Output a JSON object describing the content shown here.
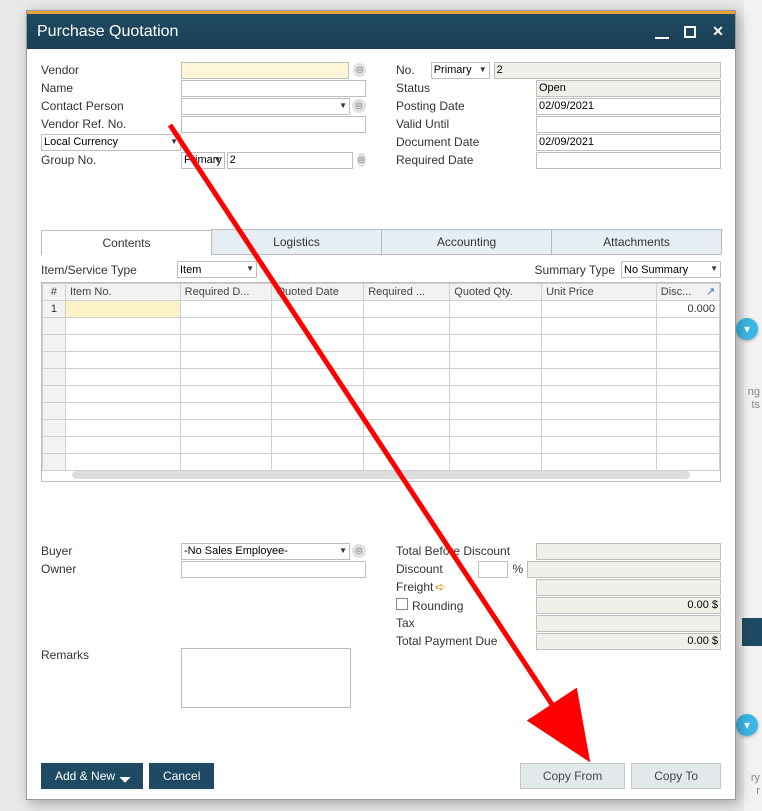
{
  "window": {
    "title": "Purchase Quotation"
  },
  "left_fields": {
    "vendor_label": "Vendor",
    "name_label": "Name",
    "contact_label": "Contact Person",
    "vendorref_label": "Vendor Ref. No.",
    "currency_label": "Local Currency",
    "groupno_label": "Group No.",
    "group_primary": "Primary",
    "group_value": "2"
  },
  "right_fields": {
    "no_label": "No.",
    "no_primary": "Primary",
    "no_value": "2",
    "status_label": "Status",
    "status_value": "Open",
    "posting_label": "Posting Date",
    "posting_value": "02/09/2021",
    "valid_label": "Valid Until",
    "docdate_label": "Document Date",
    "docdate_value": "02/09/2021",
    "required_label": "Required Date"
  },
  "tabs": {
    "contents": "Contents",
    "logistics": "Logistics",
    "accounting": "Accounting",
    "attachments": "Attachments"
  },
  "sub": {
    "itemtype_label": "Item/Service Type",
    "itemtype_value": "Item",
    "summary_label": "Summary Type",
    "summary_value": "No Summary"
  },
  "table": {
    "headers": [
      "#",
      "Item No.",
      "Required D...",
      "Quoted Date",
      "Required ...",
      "Quoted Qty.",
      "Unit Price",
      "Disc..."
    ],
    "first_row_num": "1",
    "first_row_disc": "0.000"
  },
  "buyer": {
    "label": "Buyer",
    "value": "-No Sales Employee-",
    "owner_label": "Owner"
  },
  "totals": {
    "before_label": "Total Before Discount",
    "discount_label": "Discount",
    "percent_sign": "%",
    "freight_label": "Freight",
    "rounding_label": "Rounding",
    "rounding_value": "0.00 $",
    "tax_label": "Tax",
    "due_label": "Total Payment Due",
    "due_value": "0.00 $"
  },
  "remarks_label": "Remarks",
  "footer": {
    "addnew": "Add & New",
    "cancel": "Cancel",
    "copyfrom": "Copy From",
    "copyto": "Copy To"
  },
  "bg": {
    "text1": "ng",
    "text2": "ts",
    "text3": "ry",
    "text4": "r"
  }
}
